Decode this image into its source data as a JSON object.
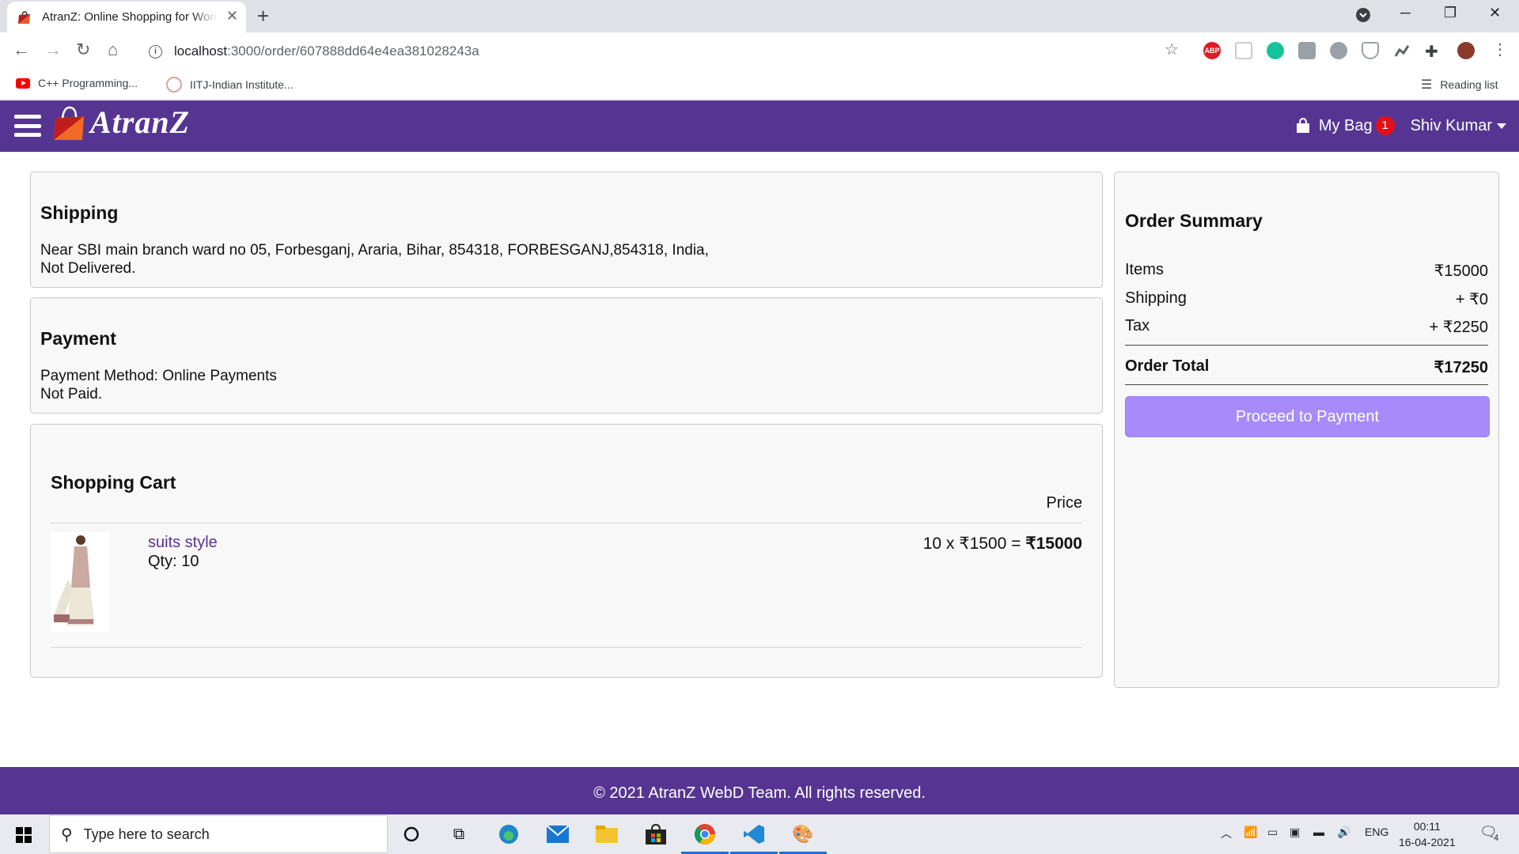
{
  "browser": {
    "tab_title": "AtranZ: Online Shopping for Women",
    "url_host": "localhost",
    "url_path": ":3000/order/607888dd64e4ea381028243a",
    "bookmarks": [
      "C++ Programming...",
      "IITJ-Indian Institute..."
    ],
    "reading_list": "Reading list",
    "ext_abp": "ABP"
  },
  "navbar": {
    "logo_text": "AtranZ",
    "bag_label": "My Bag",
    "bag_count": "1",
    "user_name": "Shiv Kumar"
  },
  "shipping": {
    "heading": "Shipping",
    "address": "Near SBI main branch ward no 05, Forbesganj, Araria, Bihar, 854318, FORBESGANJ,854318, India,",
    "status": "Not Delivered."
  },
  "payment": {
    "heading": "Payment",
    "method": "Payment Method: Online Payments",
    "status": "Not Paid."
  },
  "cart": {
    "heading": "Shopping Cart",
    "price_header": "Price",
    "items": [
      {
        "name": "suits style",
        "qty": "Qty: 10",
        "calc": "10 x ₹1500 = ",
        "subtotal": "₹15000"
      }
    ]
  },
  "summary": {
    "heading": "Order Summary",
    "items_label": "Items",
    "items_value": "₹15000",
    "shipping_label": "Shipping",
    "shipping_value": "+ ₹0",
    "tax_label": "Tax",
    "tax_value": "+ ₹2250",
    "total_label": "Order Total",
    "total_value": "₹17250",
    "proceed_label": "Proceed to Payment"
  },
  "footer": {
    "text": "© 2021 AtranZ WebD Team. All rights reserved."
  },
  "taskbar": {
    "search_placeholder": "Type here to search",
    "language": "ENG",
    "time": "00:11",
    "date": "16-04-2021",
    "notification_count": "4"
  },
  "colors": {
    "brand": "#563592",
    "proceed_button": "#a78bfa",
    "badge": "#e3101a"
  }
}
